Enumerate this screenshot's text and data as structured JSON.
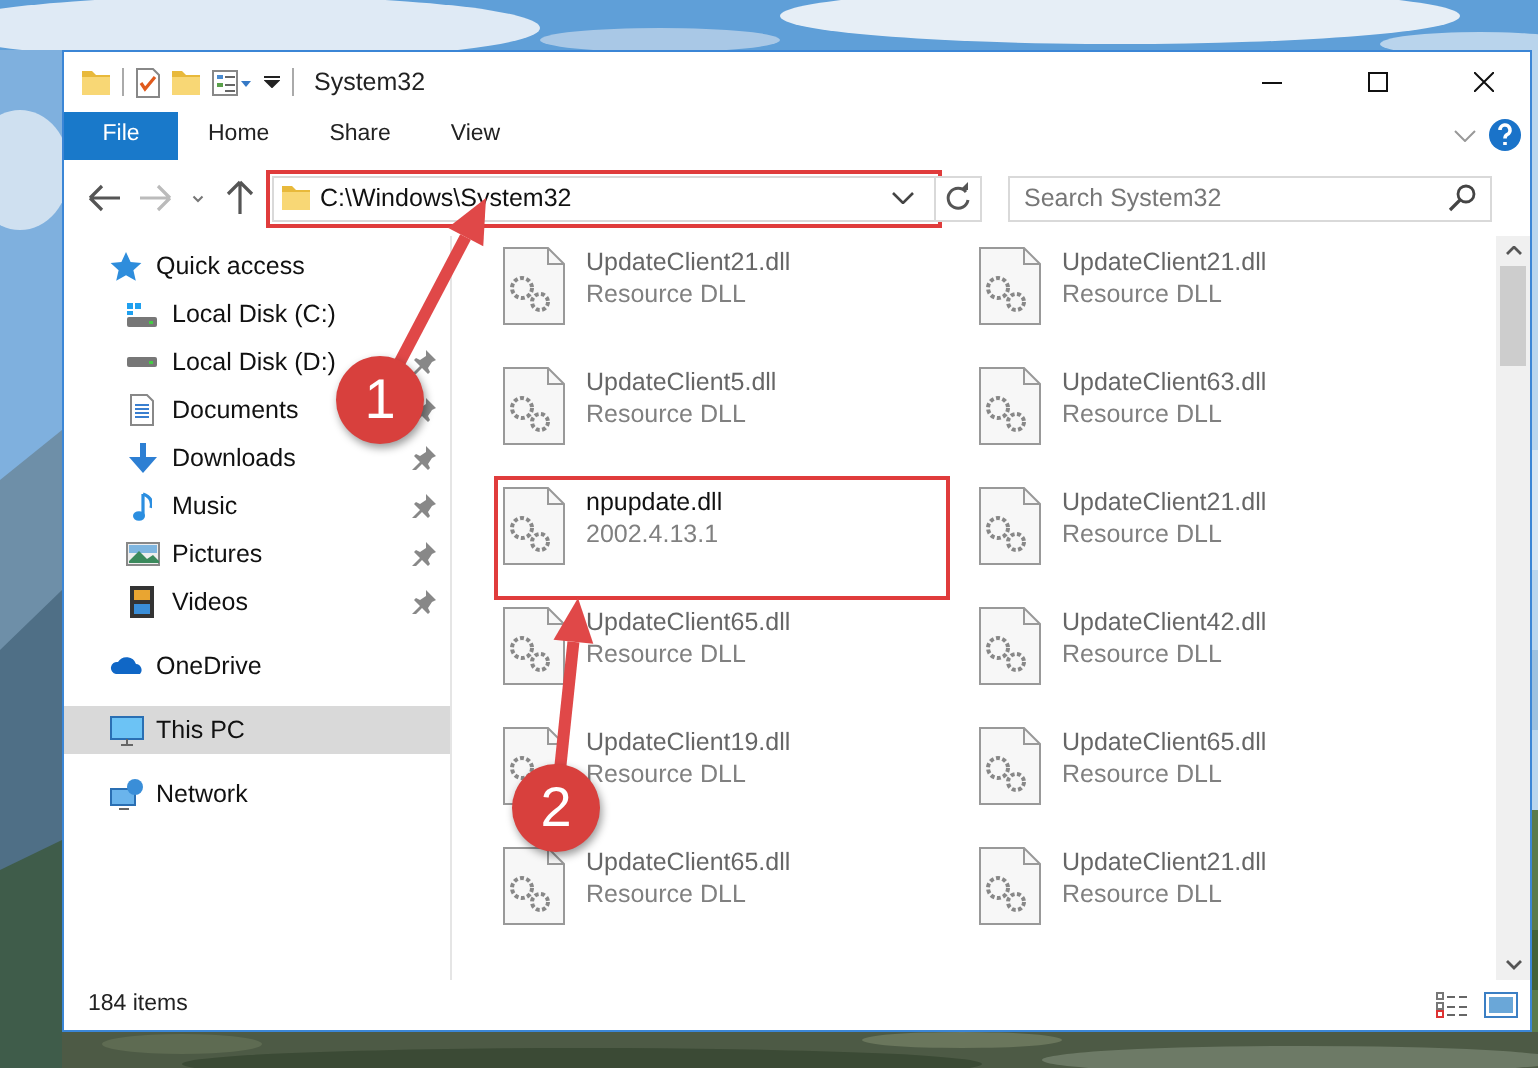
{
  "window": {
    "title": "System32"
  },
  "ribbon_tabs": [
    {
      "label": "File",
      "kind": "file"
    },
    {
      "label": "Home",
      "kind": "tab"
    },
    {
      "label": "Share",
      "kind": "tab"
    },
    {
      "label": "View",
      "kind": "tab"
    }
  ],
  "address_bar": {
    "path": "C:\\Windows\\System32",
    "highlighted": true
  },
  "search": {
    "placeholder": "Search System32"
  },
  "sidebar": {
    "items": [
      {
        "label": "Quick access",
        "selected": false,
        "children": [
          {
            "label": "Local Disk (C:)",
            "pinned": false
          },
          {
            "label": "Local Disk (D:)",
            "pinned": true
          },
          {
            "label": "Documents",
            "pinned": true
          },
          {
            "label": "Downloads",
            "pinned": true
          },
          {
            "label": "Music",
            "pinned": true
          },
          {
            "label": "Pictures",
            "pinned": true
          },
          {
            "label": "Videos",
            "pinned": true
          }
        ]
      },
      {
        "label": "OneDrive",
        "selected": false
      },
      {
        "label": "This PC",
        "selected": true
      },
      {
        "label": "Network",
        "selected": false
      }
    ]
  },
  "files": [
    {
      "name": "UpdateClient21.dll",
      "detail": "Resource DLL",
      "highlighted": false
    },
    {
      "name": "UpdateClient21.dll",
      "detail": "Resource DLL",
      "highlighted": false
    },
    {
      "name": "UpdateClient5.dll",
      "detail": "Resource DLL",
      "highlighted": false
    },
    {
      "name": "UpdateClient63.dll",
      "detail": "Resource DLL",
      "highlighted": false
    },
    {
      "name": "npupdate.dll",
      "detail": "2002.4.13.1",
      "highlighted": true
    },
    {
      "name": "UpdateClient21.dll",
      "detail": "Resource DLL",
      "highlighted": false
    },
    {
      "name": "UpdateClient65.dll",
      "detail": "Resource DLL",
      "highlighted": false
    },
    {
      "name": "UpdateClient42.dll",
      "detail": "Resource DLL",
      "highlighted": false
    },
    {
      "name": "UpdateClient19.dll",
      "detail": "Resource DLL",
      "highlighted": false
    },
    {
      "name": "UpdateClient65.dll",
      "detail": "Resource DLL",
      "highlighted": false
    },
    {
      "name": "UpdateClient65.dll",
      "detail": "Resource DLL",
      "highlighted": false
    },
    {
      "name": "UpdateClient21.dll",
      "detail": "Resource DLL",
      "highlighted": false
    }
  ],
  "status_bar": {
    "text": "184 items"
  },
  "annotations": [
    {
      "label": "1"
    },
    {
      "label": "2"
    }
  ]
}
